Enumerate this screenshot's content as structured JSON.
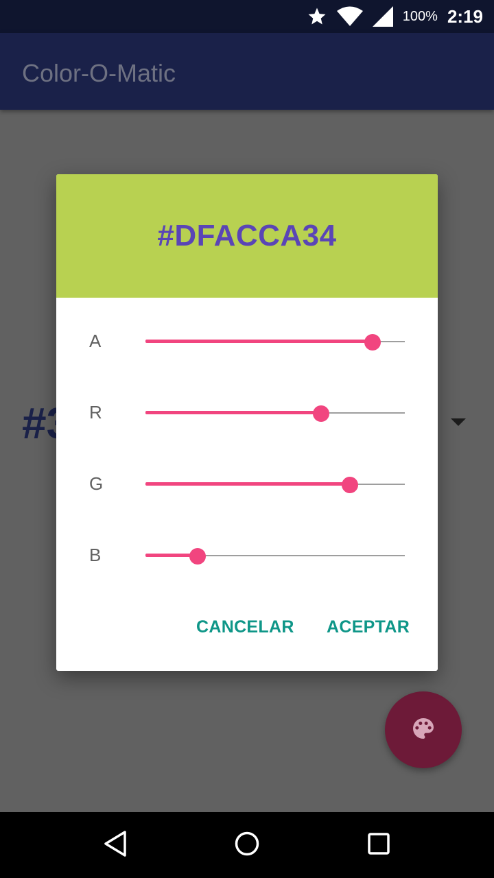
{
  "status_bar": {
    "battery": "100%",
    "time": "2:19",
    "icons": [
      "star-icon",
      "wifi-icon",
      "cell-signal-icon"
    ]
  },
  "app_bar": {
    "title": "Color-O-Matic"
  },
  "background": {
    "color_text_visible": "#3",
    "fab_icon": "palette-icon"
  },
  "dialog": {
    "hex": "#DFACCA34",
    "header_color": "#b8d151",
    "hex_text_color": "#5a45b6",
    "sliders": [
      {
        "label": "A",
        "level": 0.876
      },
      {
        "label": "R",
        "level": 0.677
      },
      {
        "label": "G",
        "level": 0.788
      },
      {
        "label": "B",
        "level": 0.2
      }
    ],
    "buttons": {
      "cancel": "CANCELAR",
      "accept": "ACEPTAR"
    }
  },
  "colors": {
    "accent": "#f1457f",
    "button_text": "#0f9688",
    "app_bar": "#1a2149"
  },
  "nav_bar": {
    "icons": [
      "back-icon",
      "home-icon",
      "recents-icon"
    ]
  }
}
